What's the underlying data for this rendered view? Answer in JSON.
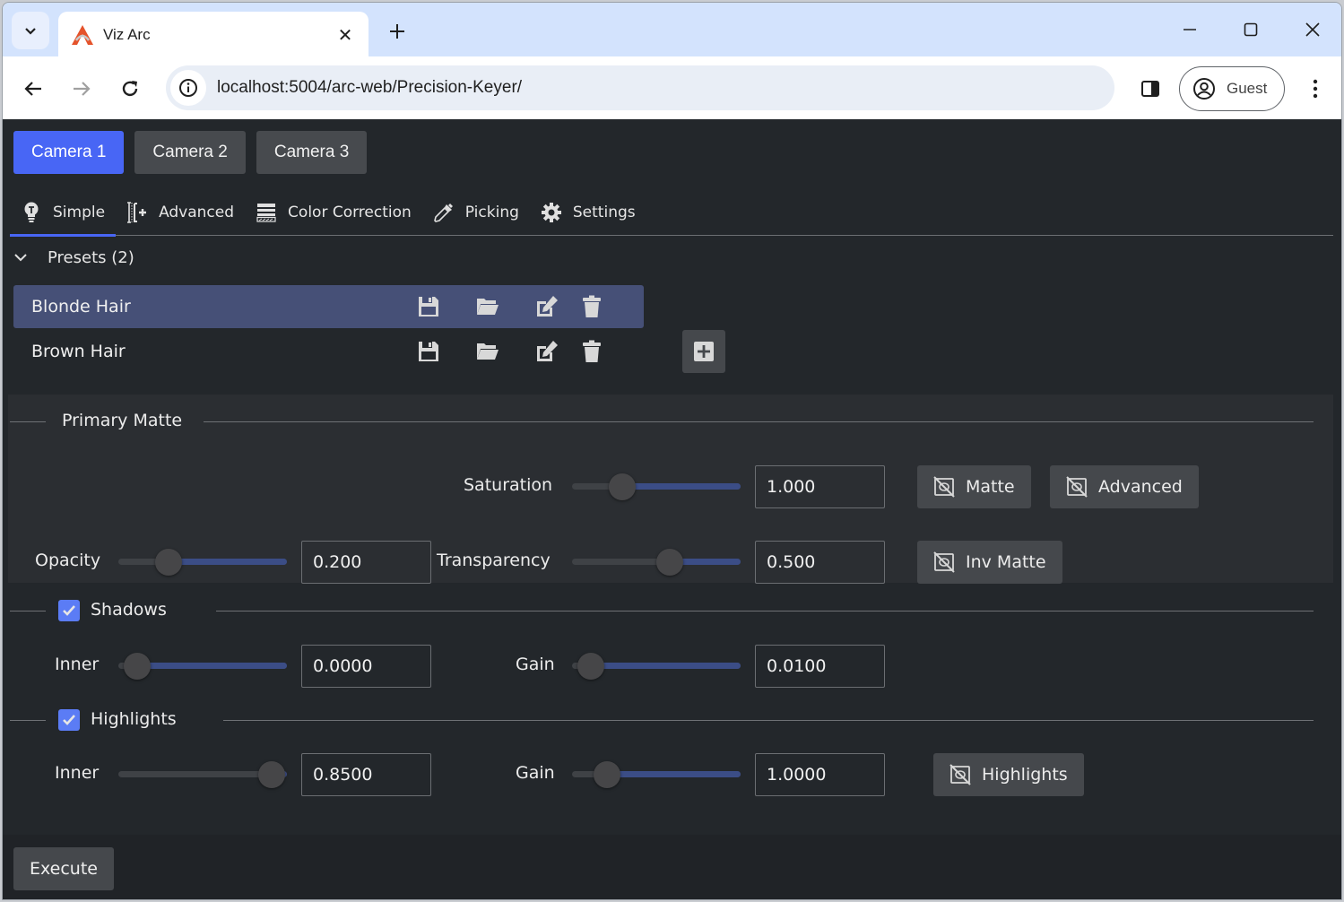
{
  "browser": {
    "tab_title": "Viz Arc",
    "url": "localhost:5004/arc-web/Precision-Keyer/",
    "profile_label": "Guest"
  },
  "cameras": [
    {
      "label": "Camera 1",
      "active": true
    },
    {
      "label": "Camera 2",
      "active": false
    },
    {
      "label": "Camera 3",
      "active": false
    }
  ],
  "tabs": [
    {
      "label": "Simple",
      "icon": "lightbulb-icon",
      "active": true
    },
    {
      "label": "Advanced",
      "icon": "advanced-icon",
      "active": false
    },
    {
      "label": "Color Correction",
      "icon": "color-correction-icon",
      "active": false
    },
    {
      "label": "Picking",
      "icon": "eyedropper-icon",
      "active": false
    },
    {
      "label": "Settings",
      "icon": "gear-icon",
      "active": false
    }
  ],
  "presets": {
    "header": "Presets (2)",
    "items": [
      {
        "name": "Blonde Hair",
        "selected": true
      },
      {
        "name": "Brown Hair",
        "selected": false
      }
    ]
  },
  "primary_matte": {
    "title": "Primary Matte",
    "saturation": {
      "label": "Saturation",
      "value": "1.000",
      "position": 0.2
    },
    "opacity": {
      "label": "Opacity",
      "value": "0.200",
      "position": 0.2
    },
    "transparency": {
      "label": "Transparency",
      "value": "0.500",
      "position": 0.5
    },
    "buttons": {
      "matte": "Matte",
      "advanced": "Advanced",
      "inv_matte": "Inv Matte"
    }
  },
  "shadows": {
    "title": "Shadows",
    "checked": true,
    "inner": {
      "label": "Inner",
      "value": "0.0000",
      "position": 0.0
    },
    "gain": {
      "label": "Gain",
      "value": "0.0100",
      "position": 0.0
    }
  },
  "highlights": {
    "title": "Highlights",
    "checked": true,
    "inner": {
      "label": "Inner",
      "value": "0.8500",
      "position": 0.85
    },
    "gain": {
      "label": "Gain",
      "value": "1.0000",
      "position": 0.1
    },
    "button": "Highlights"
  },
  "footer": {
    "execute_label": "Execute"
  },
  "colors": {
    "accent": "#4866f5",
    "selected_row": "#465077",
    "slider_fill": "#3b4d86"
  }
}
